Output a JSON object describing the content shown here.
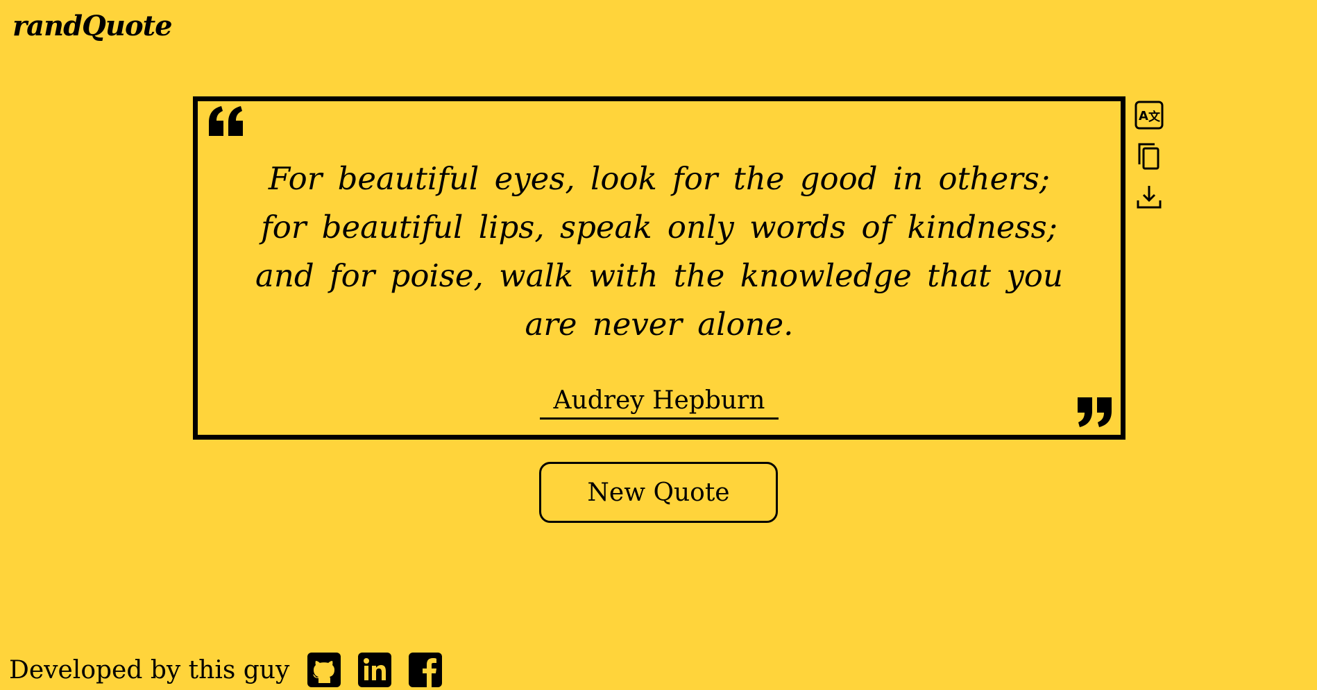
{
  "app": {
    "logo": "randQuote"
  },
  "quote": {
    "text": "For beautiful eyes, look for the good in others; for beautiful lips, speak only words of kindness; and for poise, walk with the knowledge that you are never alone.",
    "author": "Audrey Hepburn"
  },
  "tools": {
    "translate_icon": "translate-icon",
    "copy_icon": "copy-icon",
    "download_icon": "download-icon"
  },
  "actions": {
    "new_quote_label": "New Quote"
  },
  "footer": {
    "text": "Developed by this guy",
    "links": [
      "github-icon",
      "linkedin-icon",
      "facebook-icon"
    ]
  },
  "colors": {
    "background": "#FFD43B",
    "foreground": "#000000"
  }
}
